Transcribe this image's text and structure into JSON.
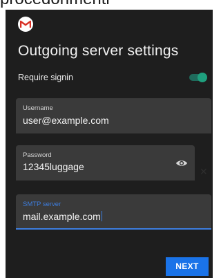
{
  "header": {
    "cut_off_text": "procedonmentl"
  },
  "app": {
    "logo_icon": "gmail-icon",
    "title": "Outgoing server settings"
  },
  "require_signin": {
    "label": "Require signin",
    "enabled": true,
    "accent_color": "#1fa07e"
  },
  "username": {
    "label": "Username",
    "value": "user@example.com"
  },
  "password": {
    "label": "Password",
    "value": "12345luggage",
    "toggle_icon": "eye-icon"
  },
  "smtp_server": {
    "label": "SMTP server",
    "value": "mail.example.com",
    "focused": true,
    "focus_color": "#3d7ee0"
  },
  "actions": {
    "next_label": "NEXT",
    "next_color": "#1a73e8"
  }
}
